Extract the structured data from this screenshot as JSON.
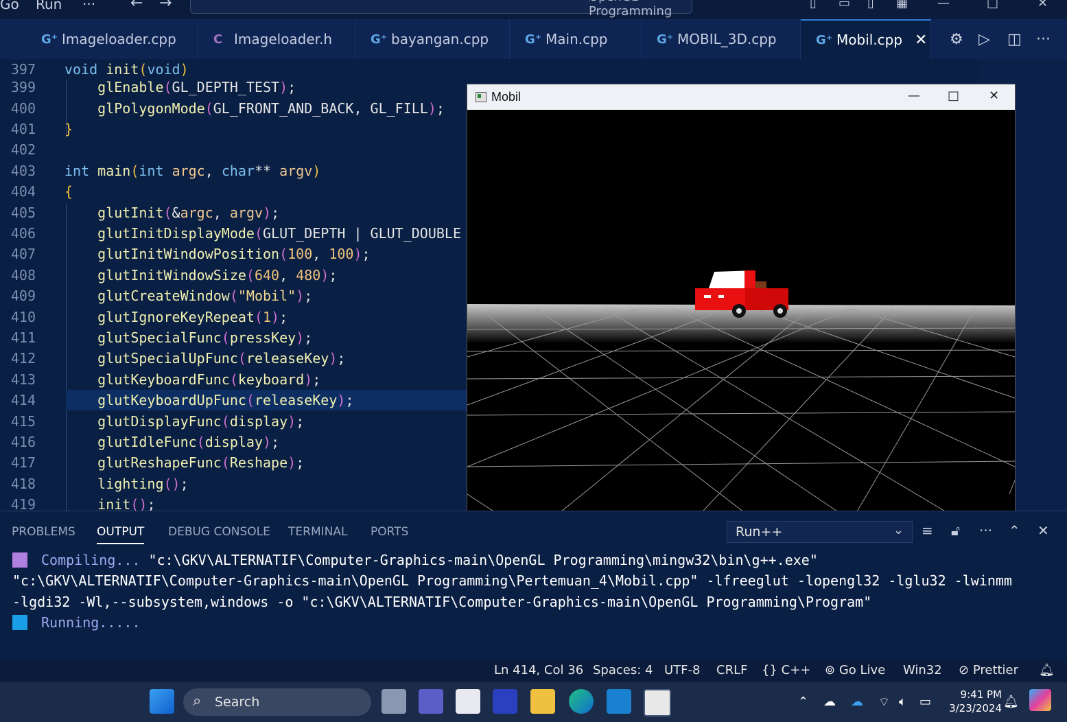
{
  "titlebar": {
    "menu_go": "Go",
    "menu_run": "Run",
    "menu_more": "···",
    "search_text": "OpenGL Programming"
  },
  "tabs": [
    {
      "icon": "cpp",
      "label": "Imageloader.cpp"
    },
    {
      "icon": "c",
      "label": "Imageloader.h"
    },
    {
      "icon": "cpp",
      "label": "bayangan.cpp"
    },
    {
      "icon": "cpp",
      "label": "Main.cpp"
    },
    {
      "icon": "cpp",
      "label": "MOBIL_3D.cpp"
    },
    {
      "icon": "cpp",
      "label": "Mobil.cpp",
      "active": true
    }
  ],
  "editor": {
    "lines": [
      {
        "n": "397",
        "code": "void init(void)"
      },
      {
        "n": "399",
        "code": "    glEnable(GL_DEPTH_TEST);"
      },
      {
        "n": "400",
        "code": "    glPolygonMode(GL_FRONT_AND_BACK, GL_FILL);"
      },
      {
        "n": "401",
        "code": "}"
      },
      {
        "n": "402",
        "code": ""
      },
      {
        "n": "403",
        "code": "int main(int argc, char** argv)"
      },
      {
        "n": "404",
        "code": "{"
      },
      {
        "n": "405",
        "code": "    glutInit(&argc, argv);"
      },
      {
        "n": "406",
        "code": "    glutInitDisplayMode(GLUT_DEPTH | GLUT_DOUBLE"
      },
      {
        "n": "407",
        "code": "    glutInitWindowPosition(100, 100);"
      },
      {
        "n": "408",
        "code": "    glutInitWindowSize(640, 480);"
      },
      {
        "n": "409",
        "code": "    glutCreateWindow(\"Mobil\");"
      },
      {
        "n": "410",
        "code": "    glutIgnoreKeyRepeat(1);"
      },
      {
        "n": "411",
        "code": "    glutSpecialFunc(pressKey);"
      },
      {
        "n": "412",
        "code": "    glutSpecialUpFunc(releaseKey);"
      },
      {
        "n": "413",
        "code": "    glutKeyboardFunc(keyboard);"
      },
      {
        "n": "414",
        "code": "    glutKeyboardUpFunc(releaseKey);"
      },
      {
        "n": "415",
        "code": "    glutDisplayFunc(display);"
      },
      {
        "n": "416",
        "code": "    glutIdleFunc(display);"
      },
      {
        "n": "417",
        "code": "    glutReshapeFunc(Reshape);"
      },
      {
        "n": "418",
        "code": "    lighting();"
      },
      {
        "n": "419",
        "code": "    init();"
      }
    ]
  },
  "glwindow": {
    "title": "Mobil"
  },
  "panel": {
    "tabs": [
      "PROBLEMS",
      "OUTPUT",
      "DEBUG CONSOLE",
      "TERMINAL",
      "PORTS"
    ],
    "active_tab": "OUTPUT",
    "output_channel": "Run++",
    "output": {
      "compiling_label": "Compiling...",
      "compile_cmd_1": " \"c:\\GKV\\ALTERNATIF\\Computer-Graphics-main\\OpenGL Programming\\mingw32\\bin\\g++.exe\"",
      "compile_cmd_2": "\"c:\\GKV\\ALTERNATIF\\Computer-Graphics-main\\OpenGL Programming\\Pertemuan_4\\Mobil.cpp\" -lfreeglut -lopengl32 -lglu32 -lwinmm",
      "compile_cmd_3": "-lgdi32 -Wl,--subsystem,windows -o \"c:\\GKV\\ALTERNATIF\\Computer-Graphics-main\\OpenGL Programming\\Program\"",
      "running_label": "Running....."
    }
  },
  "statusbar": {
    "position": "Ln 414, Col 36",
    "spaces": "Spaces: 4",
    "encoding": "UTF-8",
    "eol": "CRLF",
    "language": "C++",
    "golive": "Go Live",
    "platform": "Win32",
    "prettier": "Prettier"
  },
  "taskbar": {
    "search_placeholder": "Search",
    "time": "9:41 PM",
    "date": "3/23/2024"
  },
  "colors": {
    "editor_bg": "#0a1f44",
    "accent": "#2f7bd8",
    "car": "#e81010"
  }
}
